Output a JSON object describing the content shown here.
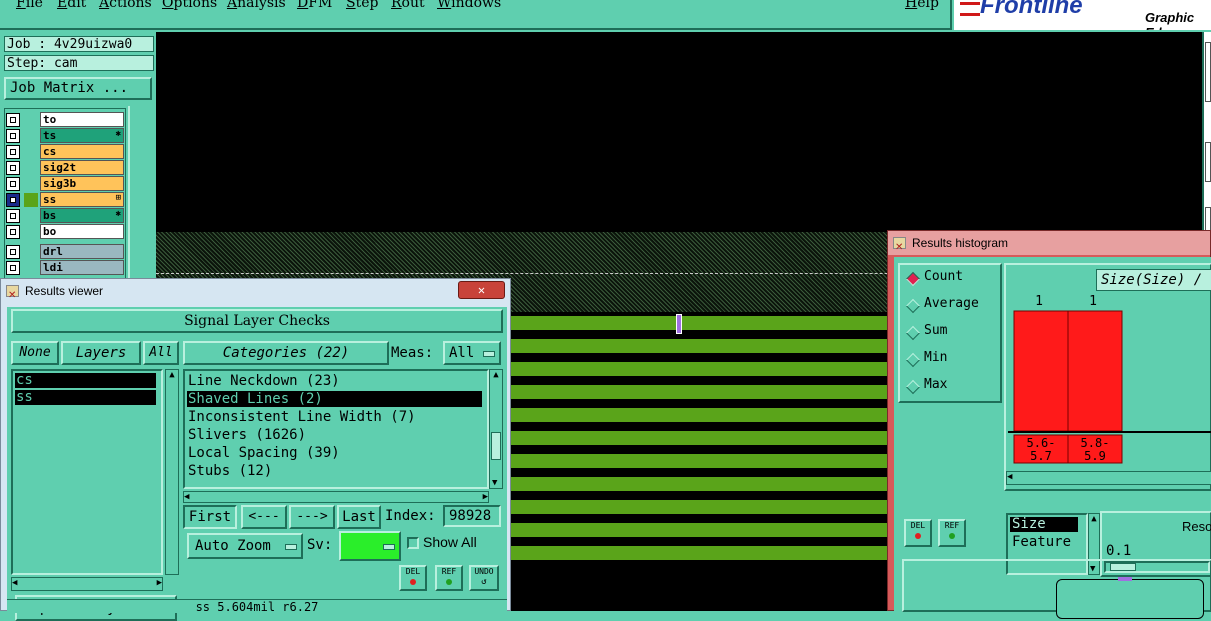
{
  "menu": {
    "items": [
      "File",
      "Edit",
      "Actions",
      "Options",
      "Analysis",
      "DFM",
      "Step",
      "Rout",
      "Windows"
    ],
    "help": "Help"
  },
  "brand": {
    "logo": "Frontline",
    "subtitle": "Graphic Ed"
  },
  "job": {
    "job_label": "Job : 4v29uizwa0",
    "step_label": "Step: cam",
    "matrix_button": "Job Matrix ..."
  },
  "layers": [
    {
      "name": "to",
      "color": "#ffffff",
      "marker": ""
    },
    {
      "name": "ts",
      "color": "#1fa27a",
      "marker": "✱"
    },
    {
      "name": "cs",
      "color": "#ffc35a",
      "marker": ""
    },
    {
      "name": "sig2t",
      "color": "#ffc35a",
      "marker": ""
    },
    {
      "name": "sig3b",
      "color": "#ffc35a",
      "marker": ""
    },
    {
      "name": "ss",
      "color": "#ffc35a",
      "marker": "⊞"
    },
    {
      "name": "bs",
      "color": "#1fa27a",
      "marker": "✱"
    },
    {
      "name": "bo",
      "color": "#ffffff",
      "marker": ""
    },
    {
      "name": "drl",
      "color": "#9ab8c0",
      "marker": ""
    },
    {
      "name": "ldi",
      "color": "#9ab8c0",
      "marker": ""
    }
  ],
  "results_viewer": {
    "title": "Results viewer",
    "close": "✕",
    "header": "Signal Layer Checks",
    "none_btn": "None",
    "layers_btn": "Layers",
    "all_btn": "All",
    "selected_layers": [
      "cs",
      "ss"
    ],
    "categories_btn": "Categories (22)",
    "meas_label": "Meas:",
    "meas_value": "All",
    "categories": [
      {
        "label": "Line Neckdown (23)",
        "selected": false
      },
      {
        "label": "Shaved Lines (2)",
        "selected": true
      },
      {
        "label": "Inconsistent Line Width (7)",
        "selected": false
      },
      {
        "label": "Slivers (1626)",
        "selected": false
      },
      {
        "label": "Local Spacing (39)",
        "selected": false
      },
      {
        "label": "Stubs (12)",
        "selected": false
      }
    ],
    "first_btn": "First",
    "prev_btn": "<---",
    "next_btn": "--->",
    "last_btn": "Last",
    "index_label": "Index:",
    "index_value": "98928",
    "auto_zoom": "Auto Zoom",
    "sv_label": "Sv:",
    "show_all": "Show All",
    "replace_layers": "Replace layers",
    "del_btn": "DEL",
    "ref_btn": "REF",
    "undo_btn": "UNDO",
    "status": "ss 5.604mil r6.27"
  },
  "histogram": {
    "title": "Results histogram",
    "modes": [
      {
        "label": "Count",
        "selected": true
      },
      {
        "label": "Average",
        "selected": false
      },
      {
        "label": "Sum",
        "selected": false
      },
      {
        "label": "Min",
        "selected": false
      },
      {
        "label": "Max",
        "selected": false
      }
    ],
    "size_field": "Size(Size) /",
    "del_btn": "DEL",
    "ref_btn": "REF",
    "attr_list": [
      {
        "label": "Size",
        "selected": true
      },
      {
        "label": "Feature",
        "selected": false
      }
    ],
    "reso_label": "Reso",
    "reso_value": "0.1"
  },
  "chart_data": {
    "type": "bar",
    "categories": [
      "5.6-5.7",
      "5.8-5.9"
    ],
    "values": [
      1,
      1
    ],
    "bar_color": "#ff1a1a"
  },
  "colors": {
    "panel": "#5fcfaf",
    "canvas": "#000000",
    "copper": "#5aa41a",
    "accent_red": "#e02050"
  }
}
